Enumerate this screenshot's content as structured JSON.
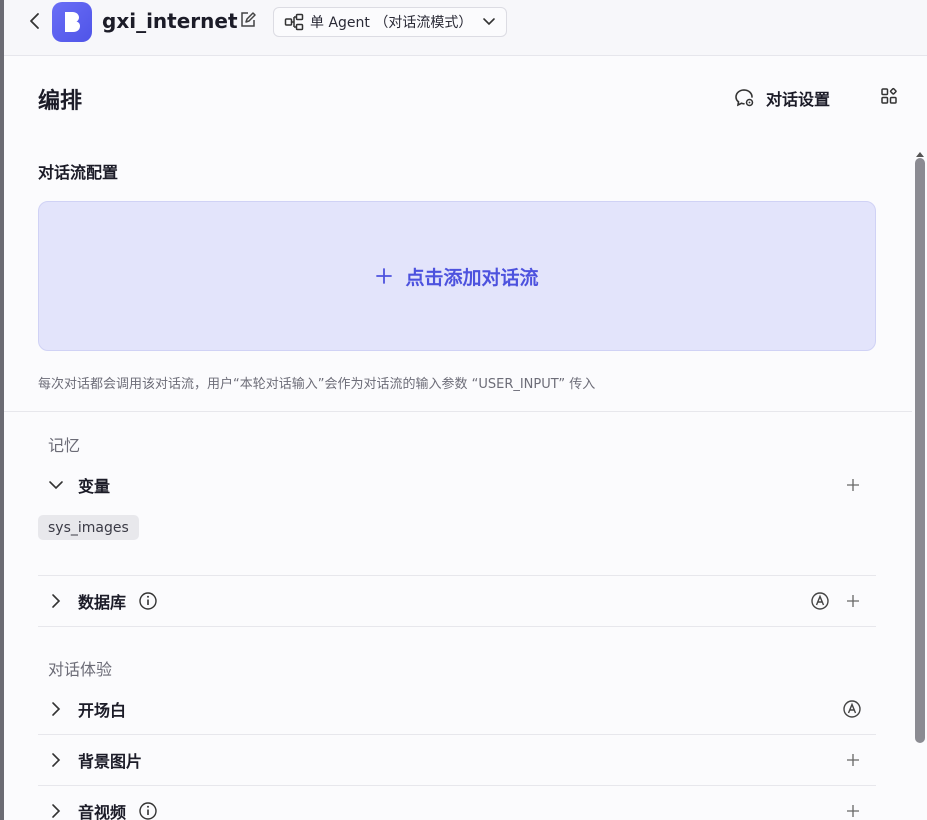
{
  "header": {
    "app_name": "gxi_internet",
    "mode_label": "单 Agent （对话流模式）"
  },
  "page": {
    "title": "编排",
    "chat_settings_label": "对话设置"
  },
  "flow_config": {
    "title": "对话流配置",
    "add_label": "点击添加对话流",
    "hint": "每次对话都会调用该对话流，用户“本轮对话输入”会作为对话流的输入参数 “USER_INPUT” 传入"
  },
  "memory": {
    "title": "记忆",
    "variables_label": "变量",
    "variable_tags": [
      "sys_images"
    ],
    "database_label": "数据库"
  },
  "experience": {
    "title": "对话体验",
    "opening_label": "开场白",
    "background_label": "背景图片",
    "audio_video_label": "音视频"
  },
  "colors": {
    "accent": "#4d52de",
    "accent_bg": "#e3e4fb"
  }
}
